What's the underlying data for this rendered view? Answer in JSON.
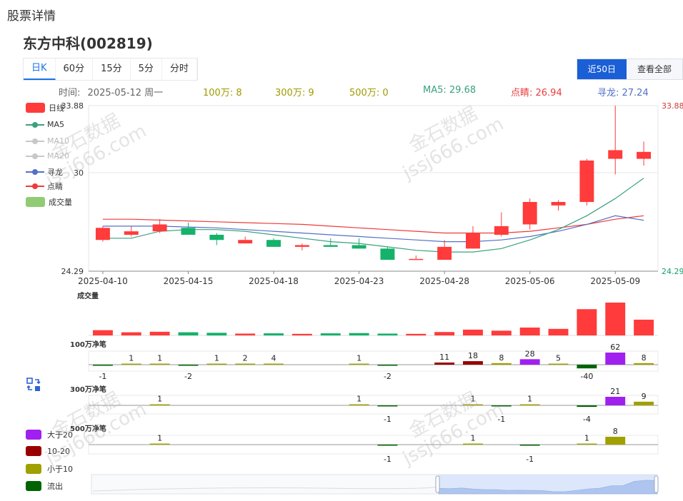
{
  "page": {
    "breadcrumb": "股票详情",
    "stock_title": "东方中科(002819)"
  },
  "period_tabs": [
    {
      "label": "日K",
      "active": true
    },
    {
      "label": "60分",
      "active": false
    },
    {
      "label": "15分",
      "active": false
    },
    {
      "label": "5分",
      "active": false
    },
    {
      "label": "分时",
      "active": false
    }
  ],
  "range_buttons": [
    {
      "label": "近50日",
      "active": true
    },
    {
      "label": "查看全部",
      "active": false
    }
  ],
  "info_bar": {
    "time_label": "时间:",
    "time_value": "2025-05-12 周一",
    "w100": "100万: 8",
    "w300": "300万: 9",
    "w500": "500万: 0",
    "ma5": "MA5: 29.68",
    "dianjing": "点睛: 26.94",
    "xunlong": "寻龙: 27.24"
  },
  "legend": [
    {
      "label": "日线",
      "type": "rect",
      "color": "#ff3b3b"
    },
    {
      "label": "MA5",
      "type": "line",
      "color": "#3aa17e"
    },
    {
      "label": "MA10",
      "type": "line",
      "color": "#c8c8c8"
    },
    {
      "label": "MA20",
      "type": "line",
      "color": "#c8c8c8"
    },
    {
      "label": "寻龙",
      "type": "line",
      "color": "#5470c6"
    },
    {
      "label": "点睛",
      "type": "line",
      "color": "#ee3b3b"
    },
    {
      "label": "成交量",
      "type": "rect",
      "color": "#91cc75"
    }
  ],
  "flow_legend": [
    {
      "label": "大于20",
      "color": "#a020f0"
    },
    {
      "label": "10-20",
      "color": "#990000"
    },
    {
      "label": "小于10",
      "color": "#a0a000"
    },
    {
      "label": "流出",
      "color": "#006400"
    }
  ],
  "watermark": {
    "line1": "金石数据",
    "line2": "jssj666.com"
  },
  "colors": {
    "up": "#ff3b3b",
    "down": "#14b26a",
    "ma5": "#3aa17e",
    "xunlong": "#5470c6",
    "dianjing": "#ee3b3b"
  },
  "chart_data": {
    "type": "candlestick",
    "y_range": [
      24.29,
      33.88
    ],
    "y_ticks": [
      "33.88",
      "30",
      "24.29"
    ],
    "y_right_high": "33.88",
    "y_right_low": "24.29",
    "x_tick_labels": [
      "2025-04-10",
      "2025-04-15",
      "2025-04-18",
      "2025-04-23",
      "2025-04-28",
      "2025-05-06",
      "2025-05-09"
    ],
    "x_tick_index": [
      0,
      3,
      6,
      9,
      12,
      15,
      18
    ],
    "candles": [
      {
        "o": 26.1,
        "c": 26.8,
        "h": 26.9,
        "l": 26.0
      },
      {
        "o": 26.4,
        "c": 26.6,
        "h": 26.9,
        "l": 26.3
      },
      {
        "o": 26.6,
        "c": 27.0,
        "h": 27.3,
        "l": 26.5
      },
      {
        "o": 26.8,
        "c": 26.4,
        "h": 27.1,
        "l": 26.4
      },
      {
        "o": 26.4,
        "c": 26.1,
        "h": 26.5,
        "l": 25.8
      },
      {
        "o": 25.9,
        "c": 26.1,
        "h": 26.3,
        "l": 25.9
      },
      {
        "o": 26.1,
        "c": 25.7,
        "h": 26.2,
        "l": 25.7
      },
      {
        "o": 25.7,
        "c": 25.8,
        "h": 25.9,
        "l": 25.5
      },
      {
        "o": 25.8,
        "c": 25.7,
        "h": 26.2,
        "l": 25.7
      },
      {
        "o": 25.8,
        "c": 25.6,
        "h": 26.2,
        "l": 25.6
      },
      {
        "o": 25.6,
        "c": 24.95,
        "h": 25.7,
        "l": 24.95
      },
      {
        "o": 24.95,
        "c": 25.0,
        "h": 25.2,
        "l": 24.95
      },
      {
        "o": 24.95,
        "c": 25.7,
        "h": 26.1,
        "l": 24.95
      },
      {
        "o": 25.6,
        "c": 26.5,
        "h": 26.9,
        "l": 25.6
      },
      {
        "o": 26.4,
        "c": 26.9,
        "h": 27.7,
        "l": 26.3
      },
      {
        "o": 27.0,
        "c": 28.3,
        "h": 28.5,
        "l": 26.7
      },
      {
        "o": 28.1,
        "c": 28.3,
        "h": 28.4,
        "l": 27.8
      },
      {
        "o": 28.3,
        "c": 30.7,
        "h": 30.8,
        "l": 28.1
      },
      {
        "o": 30.8,
        "c": 31.3,
        "h": 33.88,
        "l": 29.9
      },
      {
        "o": 30.8,
        "c": 31.2,
        "h": 31.8,
        "l": 30.4
      }
    ],
    "ma5": [
      26.2,
      26.2,
      26.6,
      26.7,
      26.7,
      26.6,
      26.4,
      26.2,
      26.0,
      25.9,
      25.7,
      25.5,
      25.4,
      25.4,
      25.6,
      26.1,
      26.7,
      27.5,
      28.5,
      29.68
    ],
    "xunlong": [
      26.9,
      26.9,
      26.9,
      26.85,
      26.8,
      26.7,
      26.6,
      26.5,
      26.4,
      26.3,
      26.2,
      26.1,
      26.0,
      26.0,
      26.1,
      26.3,
      26.6,
      27.0,
      27.5,
      27.24
    ],
    "dianjing": [
      27.3,
      27.3,
      27.25,
      27.2,
      27.15,
      27.1,
      27.05,
      27.0,
      26.9,
      26.8,
      26.7,
      26.6,
      26.5,
      26.5,
      26.5,
      26.6,
      26.8,
      27.0,
      27.3,
      27.5
    ],
    "volume": {
      "label": "成交量",
      "values": [
        20,
        12,
        14,
        12,
        10,
        7,
        8,
        6,
        8,
        9,
        7,
        6,
        13,
        22,
        18,
        30,
        25,
        100,
        125,
        60
      ]
    },
    "flow_panels": [
      {
        "label": "100万净笔",
        "values": [
          -1,
          1,
          1,
          -2,
          1,
          2,
          4,
          0,
          0,
          1,
          -2,
          0,
          11,
          18,
          8,
          28,
          5,
          -40,
          62,
          8
        ],
        "labels": [
          "-1",
          "1",
          "1",
          "-2",
          "1",
          "2",
          "4",
          "",
          "",
          "1",
          "-2",
          "",
          "11",
          "18",
          "8",
          "28",
          "5",
          "-40",
          "62",
          "8"
        ]
      },
      {
        "label": "300万净笔",
        "values": [
          0,
          0,
          1,
          0,
          0,
          0,
          0,
          0,
          0,
          1,
          -1,
          0,
          0,
          1,
          -1,
          1,
          0,
          -4,
          21,
          9
        ],
        "labels": [
          "",
          "",
          "1",
          "",
          "",
          "",
          "",
          "",
          "",
          "1",
          "-1",
          "",
          "",
          "1",
          "-1",
          "1",
          "",
          "-4",
          "21",
          "9"
        ]
      },
      {
        "label": "500万净笔",
        "values": [
          0,
          0,
          1,
          0,
          0,
          0,
          0,
          0,
          0,
          0,
          -1,
          0,
          0,
          1,
          0,
          -1,
          0,
          1,
          8,
          0
        ],
        "labels": [
          "",
          "",
          "1",
          "",
          "",
          "",
          "",
          "",
          "",
          "",
          "-1",
          "",
          "",
          "1",
          "",
          "-1",
          "",
          "1",
          "8",
          ""
        ]
      }
    ]
  }
}
